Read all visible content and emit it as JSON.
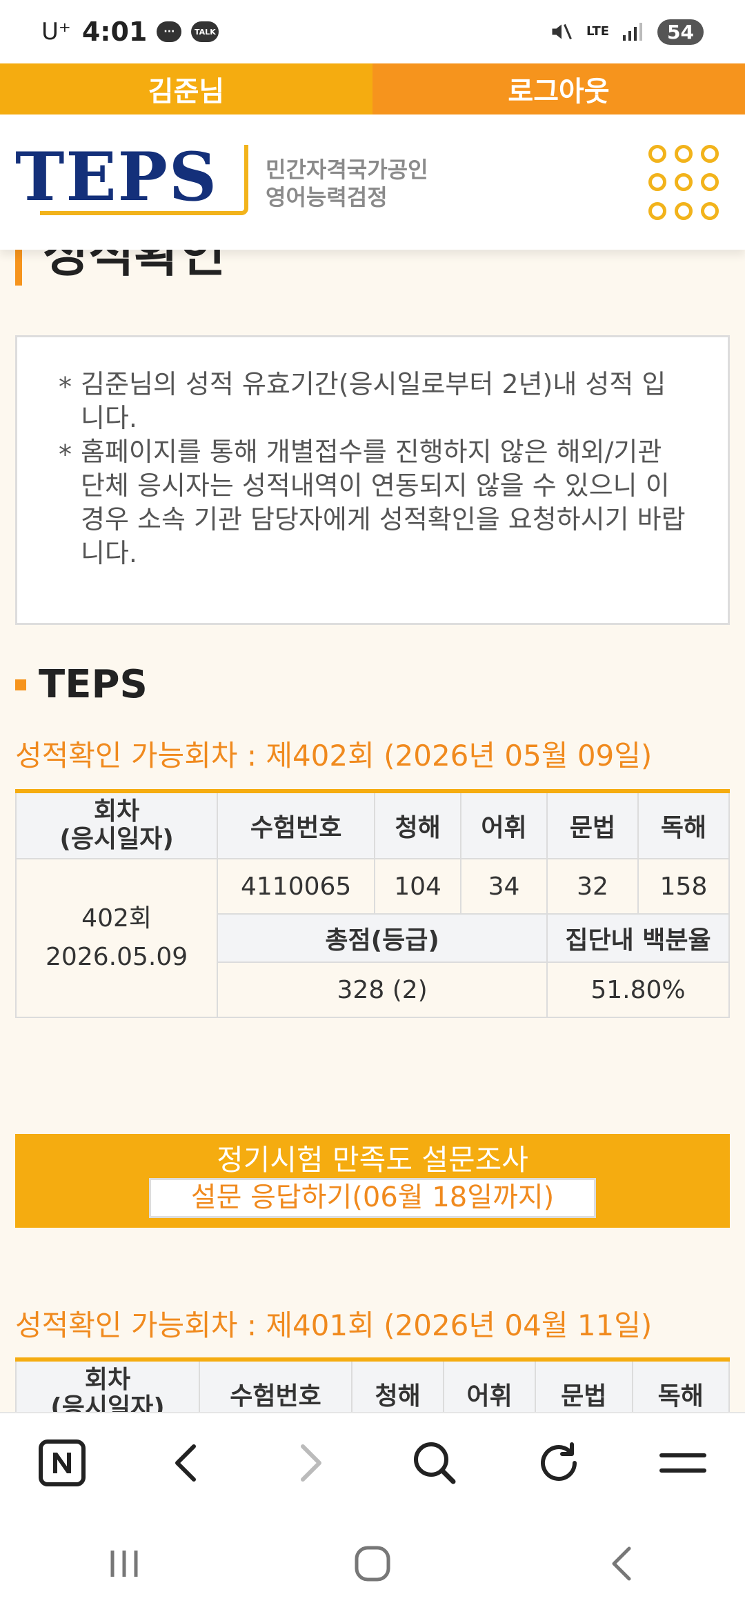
{
  "status": {
    "carrier": "U⁺",
    "time": "4:01",
    "talk_badge": "TALK",
    "lte": "LTE",
    "battery": "54"
  },
  "userbar": {
    "user": "김준님",
    "logout": "로그아웃"
  },
  "header": {
    "logo": "TEPS",
    "tagline_1": "민간자격국가공인",
    "tagline_2": "영어능력검정"
  },
  "page_title": "성적확인",
  "notice": {
    "line1": "김준님의 성적 유효기간(응시일로부터 2년)내 성적 입니다.",
    "line2": "홈페이지를 통해 개별접수를 진행하지 않은 해외/기관 단체 응시자는 성적내역이 연동되지 않을 수 있으니 이 경우 소속 기관 담당자에게 성적확인을 요청하시기 바랍니다."
  },
  "section_title": "TEPS",
  "table_headers": {
    "round": "회차\n(응시일자)",
    "exam_no": "수험번호",
    "listening": "청해",
    "vocab": "어휘",
    "grammar": "문법",
    "reading": "독해",
    "total": "총점(등급)",
    "percentile": "집단내 백분율"
  },
  "rounds": [
    {
      "title": "성적확인 가능회차 : 제402회 (2026년 05월 09일)",
      "round": "402회",
      "date": "2026.05.09",
      "exam_no": "4110065",
      "listening": "104",
      "vocab": "34",
      "grammar": "32",
      "reading": "158",
      "total": "328 (2)",
      "percentile": "51.80%"
    },
    {
      "title": "성적확인 가능회차 : 제401회 (2026년 04월 11일)"
    }
  ],
  "survey": {
    "title": "정기시험 만족도 설문조사",
    "button": "설문 응답하기(06월 18일까지)"
  },
  "icons": [
    "naver-home-icon",
    "back-icon",
    "forward-icon",
    "search-icon",
    "refresh-icon",
    "menu-icon",
    "recent-apps-icon",
    "home-icon",
    "nav-back-icon"
  ]
}
